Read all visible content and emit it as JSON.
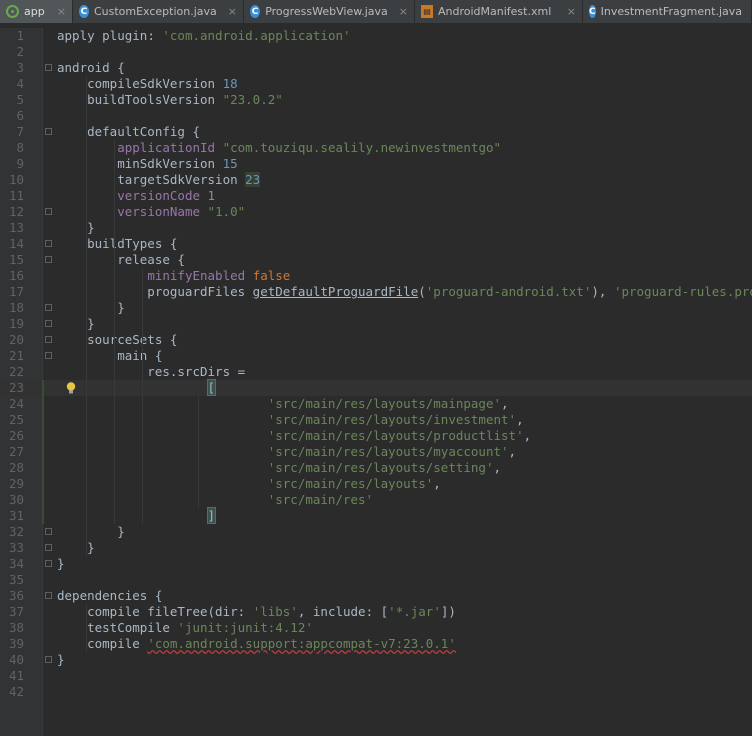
{
  "tabs": [
    {
      "label": "app",
      "icon": "gradle-icon",
      "active": true
    },
    {
      "label": "CustomException.java",
      "icon": "class-icon",
      "active": false
    },
    {
      "label": "ProgressWebView.java",
      "icon": "class-icon",
      "active": false
    },
    {
      "label": "AndroidManifest.xml",
      "icon": "xml-icon",
      "active": false
    },
    {
      "label": "InvestmentFragment.java",
      "icon": "class-icon",
      "active": false
    }
  ],
  "close_glyph": "×",
  "colors": {
    "background": "#2b2b2b",
    "keyword": "#cc7832",
    "string": "#6a8759",
    "number": "#6897bb",
    "property": "#9876aa",
    "text": "#a9b7c6"
  },
  "code_lines": [
    [
      [
        "plain",
        "apply "
      ],
      [
        "plain",
        "plugin"
      ],
      [
        "plain",
        ": "
      ],
      [
        "str",
        "'com.android.application'"
      ]
    ],
    [],
    [
      [
        "plain",
        "android {"
      ]
    ],
    [
      [
        "plain",
        "    compileSdkVersion "
      ],
      [
        "num",
        "18"
      ]
    ],
    [
      [
        "plain",
        "    buildToolsVersion "
      ],
      [
        "str",
        "\"23.0.2\""
      ]
    ],
    [],
    [
      [
        "plain",
        "    defaultConfig {"
      ]
    ],
    [
      [
        "plain",
        "        "
      ],
      [
        "prop",
        "applicationId"
      ],
      [
        "plain",
        " "
      ],
      [
        "str",
        "\"com.touziqu.sealily.newinvestmentgo\""
      ]
    ],
    [
      [
        "plain",
        "        minSdkVersion "
      ],
      [
        "num",
        "15"
      ]
    ],
    [
      [
        "plain",
        "        targetSdkVersion "
      ],
      [
        "hl23",
        "23"
      ]
    ],
    [
      [
        "plain",
        "        "
      ],
      [
        "prop",
        "versionCode"
      ],
      [
        "plain",
        " "
      ],
      [
        "num",
        "1"
      ]
    ],
    [
      [
        "plain",
        "        "
      ],
      [
        "prop",
        "versionName"
      ],
      [
        "plain",
        " "
      ],
      [
        "str",
        "\"1.0\""
      ]
    ],
    [
      [
        "plain",
        "    }"
      ]
    ],
    [
      [
        "plain",
        "    buildTypes {"
      ]
    ],
    [
      [
        "plain",
        "        release {"
      ]
    ],
    [
      [
        "plain",
        "            "
      ],
      [
        "prop",
        "minifyEnabled"
      ],
      [
        "plain",
        " "
      ],
      [
        "kw",
        "false"
      ]
    ],
    [
      [
        "plain",
        "            proguardFiles "
      ],
      [
        "mtd",
        "getDefaultProguardFile"
      ],
      [
        "plain",
        "("
      ],
      [
        "str",
        "'proguard-android.txt'"
      ],
      [
        "plain",
        "), "
      ],
      [
        "str",
        "'proguard-rules.pro'"
      ]
    ],
    [
      [
        "plain",
        "        }"
      ]
    ],
    [
      [
        "plain",
        "    }"
      ]
    ],
    [
      [
        "plain",
        "    sourceSets {"
      ]
    ],
    [
      [
        "plain",
        "        main {"
      ]
    ],
    [
      [
        "plain",
        "            res.srcDirs ="
      ]
    ],
    [
      [
        "plain",
        "                    "
      ],
      [
        "br",
        "["
      ],
      [
        "caret",
        ""
      ]
    ],
    [
      [
        "plain",
        "                            "
      ],
      [
        "str",
        "'src/main/res/layouts/mainpage'"
      ],
      [
        "plain",
        ","
      ]
    ],
    [
      [
        "plain",
        "                            "
      ],
      [
        "str",
        "'src/main/res/layouts/investment'"
      ],
      [
        "plain",
        ","
      ]
    ],
    [
      [
        "plain",
        "                            "
      ],
      [
        "str",
        "'src/main/res/layouts/productlist'"
      ],
      [
        "plain",
        ","
      ]
    ],
    [
      [
        "plain",
        "                            "
      ],
      [
        "str",
        "'src/main/res/layouts/myaccount'"
      ],
      [
        "plain",
        ","
      ]
    ],
    [
      [
        "plain",
        "                            "
      ],
      [
        "str",
        "'src/main/res/layouts/setting'"
      ],
      [
        "plain",
        ","
      ]
    ],
    [
      [
        "plain",
        "                            "
      ],
      [
        "str",
        "'src/main/res/layouts'"
      ],
      [
        "plain",
        ","
      ]
    ],
    [
      [
        "plain",
        "                            "
      ],
      [
        "str",
        "'src/main/res'"
      ]
    ],
    [
      [
        "plain",
        "                    "
      ],
      [
        "br",
        "]"
      ]
    ],
    [
      [
        "plain",
        "        }"
      ]
    ],
    [
      [
        "plain",
        "    }"
      ]
    ],
    [
      [
        "plain",
        "}"
      ]
    ],
    [],
    [
      [
        "plain",
        "dependencies {"
      ]
    ],
    [
      [
        "plain",
        "    compile fileTree("
      ],
      [
        "plain",
        "dir"
      ],
      [
        "plain",
        ": "
      ],
      [
        "str",
        "'libs'"
      ],
      [
        "plain",
        ", "
      ],
      [
        "plain",
        "include"
      ],
      [
        "plain",
        ": ["
      ],
      [
        "str",
        "'*.jar'"
      ],
      [
        "plain",
        "])"
      ]
    ],
    [
      [
        "plain",
        "    testCompile "
      ],
      [
        "str",
        "'junit:junit:4.12'"
      ]
    ],
    [
      [
        "plain",
        "    compile "
      ],
      [
        "squig",
        "'com.android.support:appcompat-v7:23.0.1'"
      ]
    ],
    [
      [
        "plain",
        "}"
      ]
    ],
    [],
    []
  ]
}
